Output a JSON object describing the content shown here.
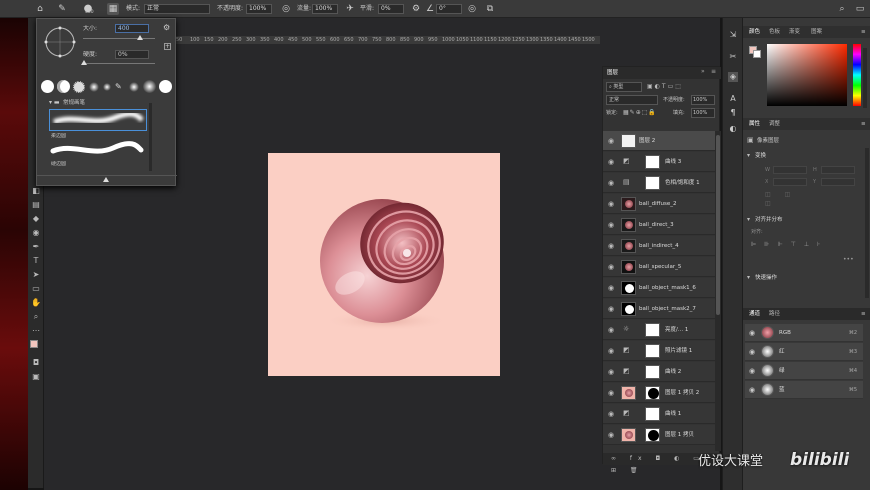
{
  "options_bar": {
    "brush_size": "400",
    "mode_label": "模式:",
    "mode_value": "正常",
    "opacity_label": "不透明度:",
    "opacity_value": "100%",
    "flow_label": "流量:",
    "flow_value": "100%",
    "smoothing_label": "平滑:",
    "smoothing_value": "0%",
    "angle_value": "0°"
  },
  "brush_popup": {
    "size_label": "大小:",
    "size_value": "400",
    "hardness_label": "硬度:",
    "hardness_value": "0%",
    "group_label": "常规画笔",
    "brush_soft": "柔边圆",
    "brush_hard": "硬边圆"
  },
  "ruler": {
    "ticks": [
      "50",
      "100",
      "150",
      "200",
      "250",
      "300",
      "350",
      "400",
      "450",
      "500",
      "550",
      "600",
      "650",
      "700",
      "750",
      "800",
      "850",
      "900",
      "950",
      "1000",
      "1050",
      "1100",
      "1150",
      "1200",
      "1250",
      "1300",
      "1350",
      "1400",
      "1450",
      "1500"
    ]
  },
  "layers_panel": {
    "tab": "图层",
    "filter": "类型",
    "blend_mode": "正常",
    "opacity_label": "不透明度:",
    "opacity_value": "100%",
    "lock_label": "锁定:",
    "fill_label": "填充:",
    "fill_value": "100%",
    "layers": [
      {
        "name": "图层 2",
        "selected": true
      },
      {
        "name": "曲线 3",
        "selected": false
      },
      {
        "name": "色相/饱和度 1",
        "selected": false
      },
      {
        "name": "ball_diffuse_2",
        "selected": false
      },
      {
        "name": "ball_direct_3",
        "selected": false
      },
      {
        "name": "ball_indirect_4",
        "selected": false
      },
      {
        "name": "ball_specular_5",
        "selected": false
      },
      {
        "name": "ball_object_mask1_6",
        "selected": false
      },
      {
        "name": "ball_object_mask2_7",
        "selected": false
      },
      {
        "name": "亮度/... 1",
        "selected": false
      },
      {
        "name": "照片滤镜 1",
        "selected": false
      },
      {
        "name": "曲线 2",
        "selected": false
      },
      {
        "name": "图层 1 拷贝 2",
        "selected": false
      },
      {
        "name": "曲线 1",
        "selected": false
      },
      {
        "name": "图层 1 拷贝",
        "selected": false
      }
    ]
  },
  "color_panel": {
    "tabs": [
      "颜色",
      "色板",
      "渐变",
      "图案"
    ]
  },
  "properties_panel": {
    "tabs": [
      "属性",
      "调整"
    ],
    "pixel_layer": "像素图层",
    "transform": "变换",
    "w_label": "W",
    "h_label": "H",
    "x_label": "X",
    "y_label": "Y",
    "align_distribute": "对齐并分布",
    "align_label": "对齐:",
    "quick_actions": "快速操作"
  },
  "channels_panel": {
    "tabs": [
      "通道",
      "路径"
    ],
    "channels": [
      {
        "name": "RGB",
        "shortcut": "⌘2"
      },
      {
        "name": "红",
        "shortcut": "⌘3"
      },
      {
        "name": "绿",
        "shortcut": "⌘4"
      },
      {
        "name": "蓝",
        "shortcut": "⌘5"
      }
    ]
  },
  "watermark": {
    "text": "优设大课堂",
    "logo": "bilibili"
  },
  "colors": {
    "canvas_bg": "#fbcfc4",
    "sphere": "#d9868e",
    "foreground": "#f2c6be"
  }
}
